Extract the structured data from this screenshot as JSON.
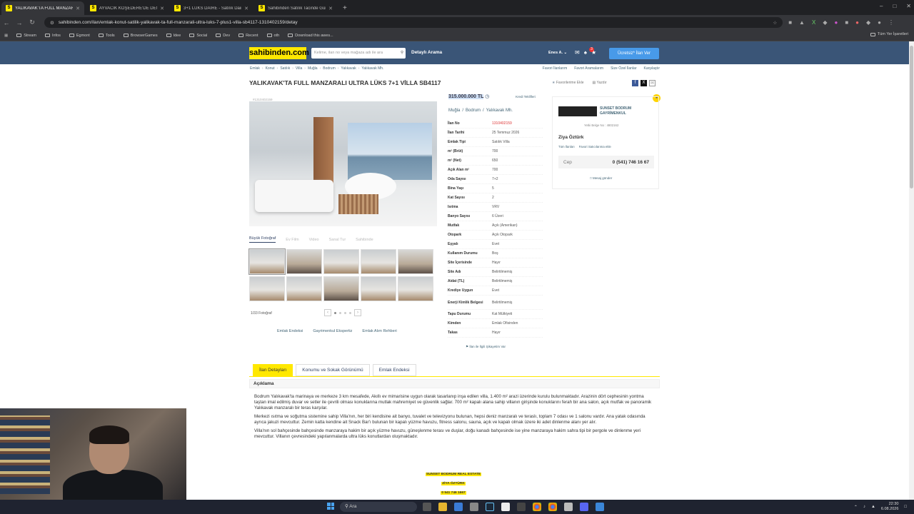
{
  "browser": {
    "tabs": [
      {
        "label": "YALIKAVAK'TA FULL MANZARA...",
        "active": true
      },
      {
        "label": "AYVACIK KÖŞEDERE'DE DENİZ ...",
        "active": false
      },
      {
        "label": "3+1 LÜKS DAİRE - Satılık Daire...",
        "active": false
      },
      {
        "label": "Sahibinden Satılık Tacinde Günü...",
        "active": false
      }
    ],
    "new_tab": "+",
    "url": "sahibinden.com/ilan/emlak-konut-satilik-yalikavak-ta-full-manzarali-ultra-luks-7-plus1-villa-sb4117-1310402159/detay",
    "bookmarks": [
      "Stream",
      "Infos",
      "Egmont",
      "Tools",
      "BrowserGames",
      "Idee",
      "Social",
      "Dev",
      "Recent",
      "oth",
      "Download this awes..."
    ],
    "bookmarks_right": "Tüm Yer İşaretleri"
  },
  "site": {
    "logo": "sahibinden.com",
    "search_placeholder": "Kelime, ilan no veya mağaza adı ile ara",
    "detailed_search": "Detaylı Arama",
    "user": "Enes A.",
    "notif_count": "3",
    "post_button": "Ücretsiz* İlan Ver",
    "breadcrumbs": [
      "Emlak",
      "Konut",
      "Satılık",
      "Villa",
      "Muğla",
      "Bodrum",
      "Yalıkavak",
      "Yalıkavak Mh."
    ],
    "top_links": [
      "Favori İlanlarım",
      "Favori Aramalarım",
      "Size Özel İlanlar",
      "Karşılaştır"
    ]
  },
  "listing": {
    "title": "YALIKAVAK'TA FULL MANZARALI ULTRA LÜKS 7+1 VİLLA SB4117",
    "add_favorite": "Favorilerime Ekle",
    "print": "Yazdır",
    "small_id": "#1310402159",
    "price": "315.000.000 TL",
    "credit": "Kredi Teklifleri",
    "location": [
      "Muğla",
      "Bodrum",
      "Yalıkavak Mh."
    ],
    "photo_tools": [
      "Büyük Fotoğraf",
      "Ev Film",
      "Video",
      "Sanal Tur",
      "Sahibinde"
    ],
    "photo_count": "1/33 Fotoğraf",
    "help_links": [
      "Emlak Endeksi",
      "Gayrimenkul Ekspertiz",
      "Emlak Alım Rehberi"
    ],
    "attributes": [
      {
        "k": "İlan No",
        "v": "1310402159",
        "red": true
      },
      {
        "k": "İlan Tarihi",
        "v": "25 Temmuz 2026"
      },
      {
        "k": "Emlak Tipi",
        "v": "Satılık Villa"
      },
      {
        "k": "m² (Brüt)",
        "v": "700"
      },
      {
        "k": "m² (Net)",
        "v": "650"
      },
      {
        "k": "Açık Alan m²",
        "v": "700"
      },
      {
        "k": "Oda Sayısı",
        "v": "7+2"
      },
      {
        "k": "Bina Yaşı",
        "v": "5"
      },
      {
        "k": "Kat Sayısı",
        "v": "2"
      },
      {
        "k": "Isıtma",
        "v": "VRV"
      },
      {
        "k": "Banyo Sayısı",
        "v": "6 Üzeri"
      },
      {
        "k": "Mutfak",
        "v": "Açık (Amerikan)"
      },
      {
        "k": "Otopark",
        "v": "Açık Otopark"
      },
      {
        "k": "Eşyalı",
        "v": "Evet"
      },
      {
        "k": "Kullanım Durumu",
        "v": "Boş"
      },
      {
        "k": "Site İçerisinde",
        "v": "Hayır"
      },
      {
        "k": "Site Adı",
        "v": "Belirtilmemiş"
      },
      {
        "k": "Aidat (TL)",
        "v": "Belirtilmemiş"
      },
      {
        "k": "Krediye Uygun",
        "v": "Evet"
      },
      {
        "k": "Enerji Kimlik Belgesi",
        "v": "Belirtilmemiş",
        "tall": true
      },
      {
        "k": "Tapu Durumu",
        "v": "Kat Mülkiyeti"
      },
      {
        "k": "Kimden",
        "v": "Emlak Ofisinden"
      },
      {
        "k": "Takas",
        "v": "Hayır"
      }
    ],
    "complain": "İlan ile İlgili Şikayetim Var"
  },
  "seller": {
    "company": "SUNSET BODRUM GAYRİMENKUL",
    "license": "Yetki Belge No : 4802162",
    "person": "Ziya Öztürk",
    "links": [
      "Tüm İlanları",
      "Favori Satıcılarıma ekle"
    ],
    "phone_label": "Cep",
    "phone": "0 (541) 746 16 67",
    "message": "Mesaj gönder"
  },
  "details": {
    "tabs": [
      "İlan Detayları",
      "Konumu ve Sokak Görünümü",
      "Emlak Endeksi"
    ],
    "section_title": "Açıklama",
    "paragraphs": [
      "Bodrum Yalıkavak'ta marinaya ve merkeze 3 km mesafede, Akıllı ev mimarisine uygun olarak tasarlanıp inşa edilen villa, 1.400 m² arazi üzerinde kurulu bulunmaktadır. Arazinin dört cephesinin yontma taştan imal edilmiş duvar ve setler ile çevrili olması konuklarına mutlak mahremiyet ve güvenlik sağlar. 700 m² kapalı alana sahip villanın girişinde konuklarını ferah bir ana salon, açık mutfak ve panoramik Yalıkavak manzaralı bir teras karşılar.",
      "Merkezi ısıtma ve soğutma sistemine sahip Villa'nın, her biri kendisine ait banyo, tuvalet ve televizyonu bulunan, hepsi deniz manzaralı ve teraslı, toplam 7 odası ve 1 salonu vardır. Ana yatak odasında ayrıca jakuzi mevcuttur. Zemin katta kendine ait Snack Bar'ı bulunan bir kapalı yüzme havuzu, fitness salonu, sauna, açık ve kapalı olmak üzere iki adet dinlenme alanı yer alır.",
      "Villa'nın sol bahçesinde bahçesinde manzaraya hakim bir açık yüzme havuzu, güneşlenme terası ve duşlar, doğu kanadı bahçesinde ise yine manzaraya hakim sahra tipi bir pergole ve dinlenme yeri mevcuttur. Villanın çevresindeki yapılanmalarda ultra lüks konutlardan oluşmaktadır."
    ],
    "signature": [
      "SUNSET BODRUM REAL ESTATE",
      "ZİYA ÖZTÜRK",
      "0 541 746 1667"
    ]
  },
  "taskbar": {
    "search": "Ara",
    "time": "22:30",
    "date": "6.08.2026"
  }
}
